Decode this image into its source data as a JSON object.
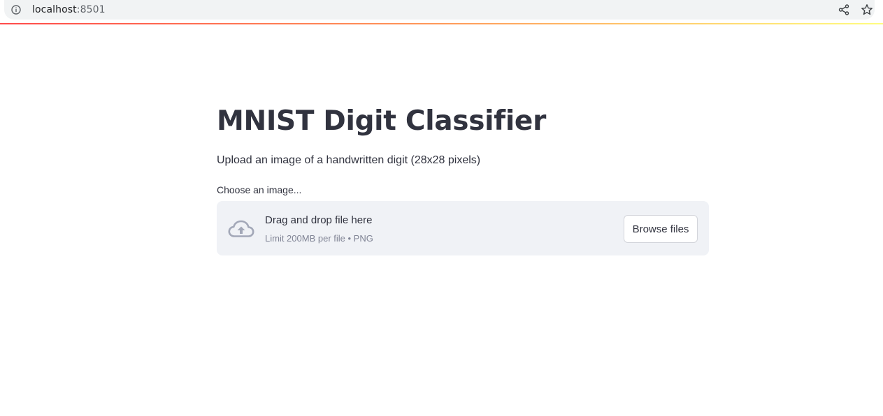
{
  "browser": {
    "url_host": "localhost",
    "url_port": ":8501",
    "icons": [
      "info-icon",
      "share-icon",
      "star-icon"
    ]
  },
  "theme": {
    "text_color": "#31333f",
    "dropzone_bg": "#f0f2f6",
    "muted_text": "#808495",
    "decoration_gradient": [
      "#ff4b4b",
      "#fffd80"
    ]
  },
  "main": {
    "title": "MNIST Digit Classifier",
    "subtitle": "Upload an image of a handwritten digit (28x28 pixels)"
  },
  "uploader": {
    "label": "Choose an image...",
    "drop_text": "Drag and drop file here",
    "limit_text": "Limit 200MB per file • PNG",
    "button_label": "Browse files",
    "icon": "cloud-upload-icon"
  }
}
